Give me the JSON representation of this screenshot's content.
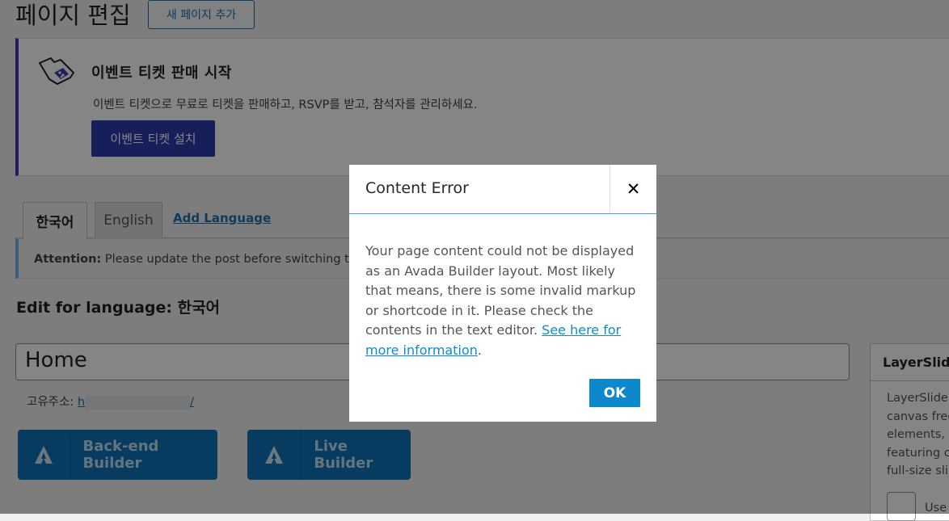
{
  "header": {
    "title": "페이지 편집",
    "add_button": "새 페이지 추가"
  },
  "notice": {
    "icon": "ticket-icon",
    "title": "이벤트 티켓 판매 시작",
    "description": "이벤트 티켓으로 무료로 티켓을 판매하고, RSVP를 받고, 참석자를 관리하세요.",
    "button": "이벤트 티켓 설치",
    "accent": "#2c3cad"
  },
  "language": {
    "tabs": [
      "한국어",
      "English"
    ],
    "add_language": "Add Language",
    "attention_label": "Attention:",
    "attention_text": " Please update the post before switching the",
    "edit_label": "Edit for language: 한국어"
  },
  "editor": {
    "title_value": "Home",
    "permalink_label": "고유주소: ",
    "permalink_start": "h",
    "permalink_end": "/"
  },
  "builders": {
    "backend": "Back-end Builder",
    "live": "Live Builder",
    "icon": "avada-icon",
    "color": "#0e72b6"
  },
  "sidebar": {
    "title": "LayerSlide",
    "lines": [
      "LayerSlider",
      "canvas free",
      "elements, r",
      "featuring c",
      "full-size sli"
    ],
    "use_label": "Use"
  },
  "modal": {
    "title": "Content Error",
    "close_icon": "close-icon",
    "body_text": "Your page content could not be displayed as an Avada Builder layout. Most likely that means, there is some invalid markup or shortcode in it. Please check the contents in the text editor. ",
    "link_text": "See here for more information",
    "body_end": ".",
    "ok_label": "OK",
    "accent": "#0e88cd"
  }
}
